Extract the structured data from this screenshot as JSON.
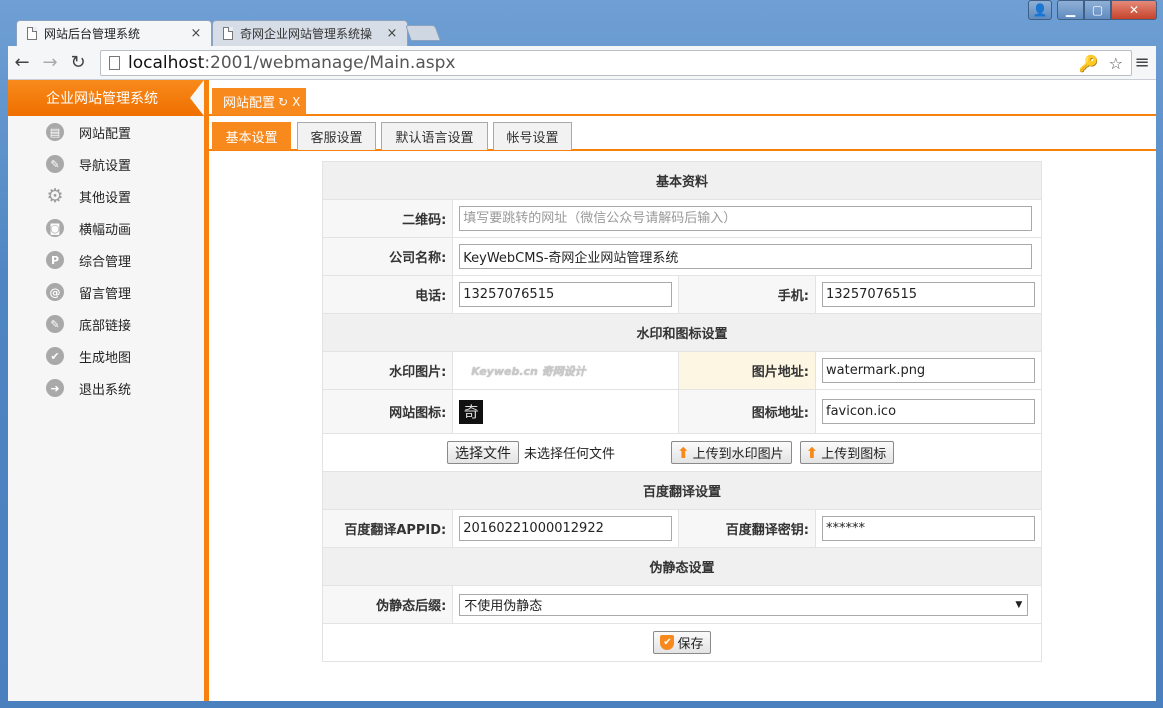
{
  "browser": {
    "tabs": [
      {
        "title": "网站后台管理系统",
        "close": "×"
      },
      {
        "title": "奇网企业网站管理系统操",
        "close": "×"
      }
    ],
    "window_controls": {
      "user": "👤",
      "minimize": "▁",
      "maximize": "▢",
      "close": "✕"
    },
    "address": {
      "host": "localhost",
      "path": ":2001/webmanage/Main.aspx"
    },
    "nav": {
      "back": "←",
      "forward": "→",
      "reload": "↻"
    },
    "omni_icons": {
      "key": "🔑",
      "star": "☆"
    },
    "menu": "≡"
  },
  "sidebar": {
    "title": "企业网站管理系统",
    "items": [
      {
        "label": "网站配置",
        "icon": "▤"
      },
      {
        "label": "导航设置",
        "icon": "✎"
      },
      {
        "label": "其他设置",
        "icon": "⚙"
      },
      {
        "label": "横幅动画",
        "icon": "◙"
      },
      {
        "label": "综合管理",
        "icon": "P"
      },
      {
        "label": "留言管理",
        "icon": "@"
      },
      {
        "label": "底部链接",
        "icon": "✎"
      },
      {
        "label": "生成地图",
        "icon": "✔"
      },
      {
        "label": "退出系统",
        "icon": "➜"
      }
    ]
  },
  "main": {
    "tab": {
      "label": "网站配置",
      "refresh": "↻",
      "close": "X"
    },
    "subtabs": [
      "基本设置",
      "客服设置",
      "默认语言设置",
      "帐号设置"
    ]
  },
  "form": {
    "sections": {
      "basic": "基本资料",
      "watermark": "水印和图标设置",
      "baidu": "百度翻译设置",
      "rewrite": "伪静态设置"
    },
    "qrcode": {
      "label": "二维码:",
      "placeholder": "填写要跳转的网址（微信公众号请解码后输入）"
    },
    "company": {
      "label": "公司名称:",
      "value": "KeyWebCMS-奇网企业网站管理系统"
    },
    "phone": {
      "label": "电话:",
      "value": "13257076515"
    },
    "mobile": {
      "label": "手机:",
      "value": "13257076515"
    },
    "watermark_img": {
      "label": "水印图片:",
      "preview": "Keyweb.cn 奇网设计"
    },
    "image_addr": {
      "label": "图片地址:",
      "value": "watermark.png"
    },
    "site_icon": {
      "label": "网站图标:",
      "preview": "奇"
    },
    "icon_addr": {
      "label": "图标地址:",
      "value": "favicon.ico"
    },
    "upload": {
      "choose_file": "选择文件",
      "no_file": "未选择任何文件",
      "to_watermark": "上传到水印图片",
      "to_icon": "上传到图标"
    },
    "baidu_appid": {
      "label": "百度翻译APPID:",
      "value": "20160221000012922"
    },
    "baidu_key": {
      "label": "百度翻译密钥:",
      "value": "******"
    },
    "rewrite_suffix": {
      "label": "伪静态后缀:",
      "selected": "不使用伪静态",
      "arrow": "▼"
    },
    "save": {
      "label": "保存",
      "icon": "✔"
    }
  }
}
